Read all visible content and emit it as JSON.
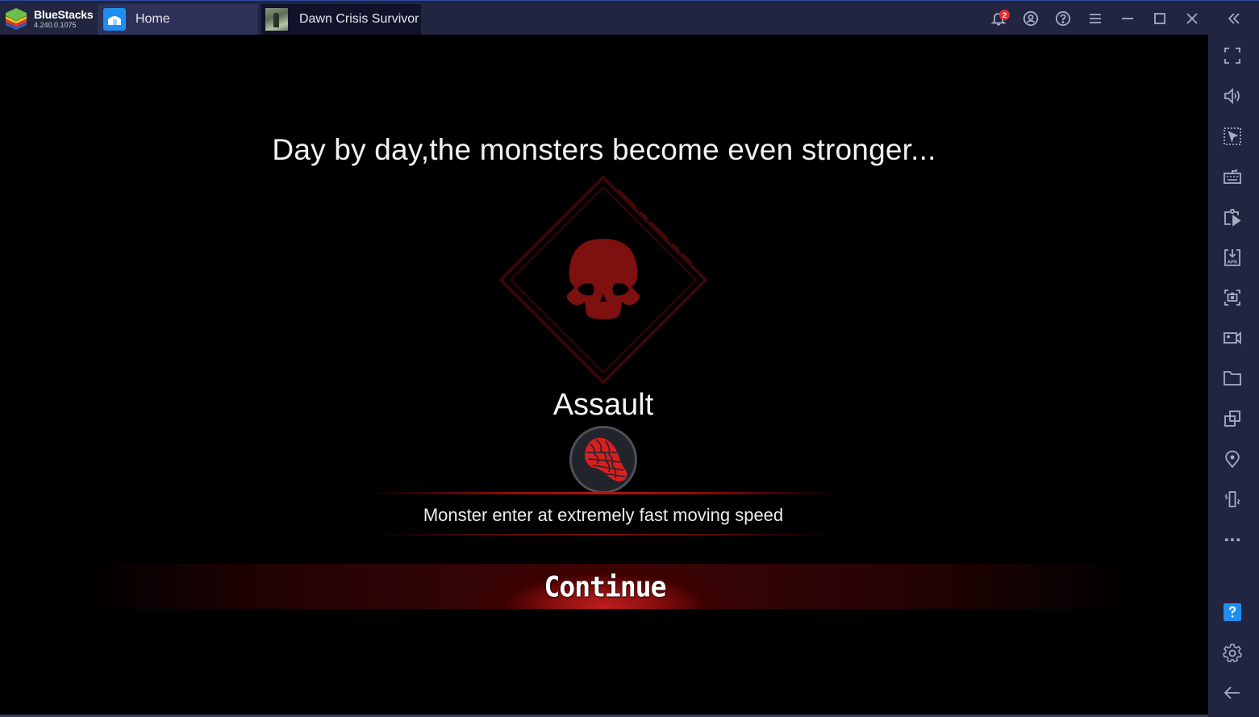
{
  "app": {
    "brand_name": "BlueStacks",
    "version": "4.240.0.1075"
  },
  "tabs": [
    {
      "label": "Home",
      "icon": "home-icon",
      "active": false
    },
    {
      "label": "Dawn Crisis  Survivor",
      "icon": "game-thumbnail",
      "active": true
    }
  ],
  "titlebar": {
    "notification_count": "2",
    "buttons": [
      "bell-icon",
      "account-icon",
      "help-icon",
      "menu-icon",
      "minimize-icon",
      "maximize-icon",
      "close-icon",
      "collapse-sidebar-icon"
    ]
  },
  "sidebar": {
    "items": [
      {
        "name": "fullscreen",
        "icon": "fullscreen-icon"
      },
      {
        "name": "volume",
        "icon": "volume-icon"
      },
      {
        "name": "pointer-mode",
        "icon": "cursor-select-icon"
      },
      {
        "name": "keyboard-controls",
        "icon": "keyboard-icon"
      },
      {
        "name": "macro-recorder",
        "icon": "macro-play-icon"
      },
      {
        "name": "install-apk",
        "icon": "apk-install-icon"
      },
      {
        "name": "screenshot",
        "icon": "camera-icon"
      },
      {
        "name": "record-screen",
        "icon": "video-camera-icon"
      },
      {
        "name": "media-folder",
        "icon": "folder-icon"
      },
      {
        "name": "multi-instance",
        "icon": "multi-instance-icon"
      },
      {
        "name": "location",
        "icon": "location-pin-icon"
      },
      {
        "name": "shake",
        "icon": "shake-icon"
      },
      {
        "name": "more",
        "icon": "more-dots-icon"
      },
      {
        "name": "help",
        "icon": "help-square-icon"
      },
      {
        "name": "settings",
        "icon": "gear-icon"
      },
      {
        "name": "back",
        "icon": "back-arrow-icon"
      }
    ]
  },
  "game": {
    "headline": "Day by day,the monsters become even stronger...",
    "mode_title": "Assault",
    "mode_icon": "footprint-icon",
    "description": "Monster enter at extremely fast moving speed",
    "continue_label": "Continue"
  },
  "colors": {
    "chrome_bg": "#222540",
    "accent_blue": "#1f8ef1",
    "badge_red": "#e03131",
    "game_red": "#8b1111",
    "skull_red": "#7e1010"
  }
}
